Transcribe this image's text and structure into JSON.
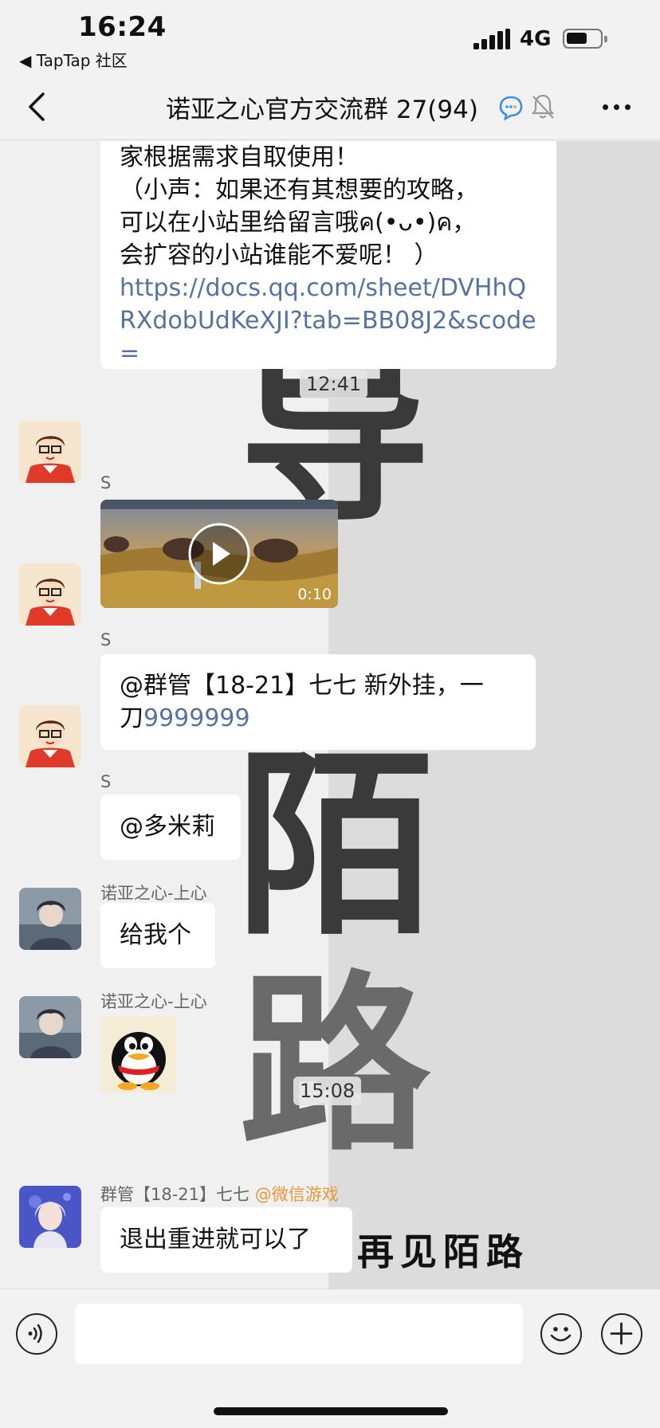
{
  "status_bar": {
    "time": "16:24",
    "back_app": "◀ TapTap 社区",
    "network": "4G"
  },
  "header": {
    "title": "诺亚之心官方交流群 27(94)",
    "icons": [
      "back-chevron-icon",
      "qq-chat-icon",
      "mute-bell-icon",
      "more-dots-icon"
    ]
  },
  "wallpaper": {
    "glyph_top": "导",
    "glyph_middle": "陌",
    "glyph_bottom": "路",
    "caption": "再见陌路"
  },
  "messages": {
    "m0": {
      "lines": [
        "家根据需求自取使用！",
        "（小声：如果还有其想要的攻略，",
        "可以在小站里给留言哦ค(•ᴗ•)ค，",
        "会扩容的小站谁能不爱呢！ ）"
      ],
      "link": "https://docs.qq.com/sheet/DVHhQRXdobUdKeXJI?tab=BB08J2&scode="
    },
    "time1": "12:41",
    "m1": {
      "sender": "S",
      "type": "video",
      "duration": "0:10"
    },
    "m2": {
      "sender": "S",
      "text_prefix": "@群管【18-21】七七  新外挂，一",
      "text_prefix2": "刀",
      "number": "9999999"
    },
    "m3": {
      "sender": "S",
      "text": "@多米莉"
    },
    "m4": {
      "sender": "诺亚之心-上心",
      "text": "给我个"
    },
    "m5": {
      "sender": "诺亚之心-上心",
      "type": "sticker",
      "sticker": "qq-penguin-sticker"
    },
    "time2": "15:08",
    "m6": {
      "sender": "群管【18-21】七七",
      "sender_tag": "@微信游戏",
      "text": "退出重进就可以了"
    }
  },
  "input_bar": {
    "placeholder": "",
    "icons": [
      "voice-icon",
      "emoji-icon",
      "plus-icon"
    ]
  }
}
